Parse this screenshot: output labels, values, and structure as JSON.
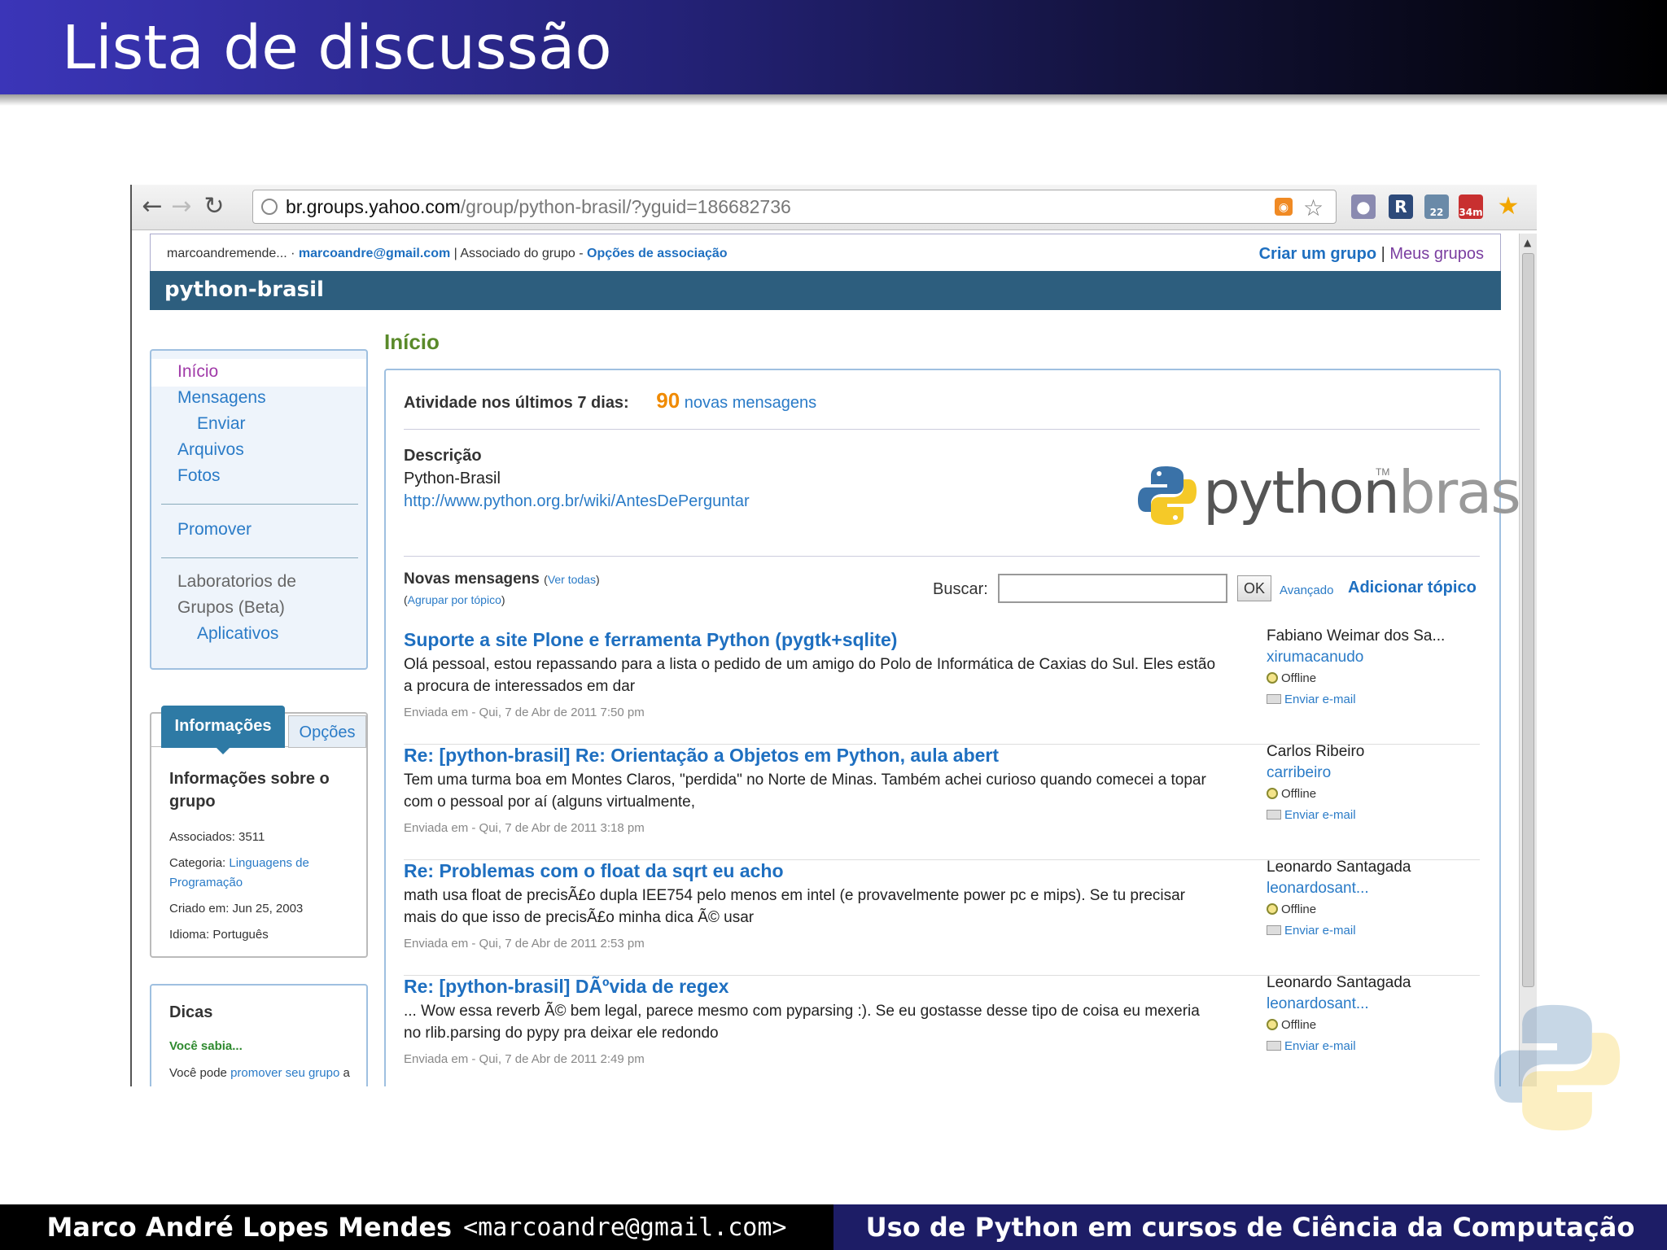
{
  "slide": {
    "title": "Lista de discussão",
    "footer_author": "Marco André Lopes Mendes",
    "footer_email": "<marcoandre@gmail.com>",
    "footer_talk": "Uso de Python em cursos de Ciência da Computação"
  },
  "browser": {
    "url_host": "br.groups.yahoo.com",
    "url_path": "/group/python-brasil/?yguid=186682736",
    "ext_badge_1": "22",
    "ext_badge_2": "34m"
  },
  "userbar": {
    "user": "marcoandremende... · ",
    "email": "marcoandre@gmail.com",
    "role": " | Associado do grupo - ",
    "options": "Opções de associação",
    "create": "Criar um grupo",
    "sep": " | ",
    "mine": "Meus grupos"
  },
  "group": {
    "name": "python-brasil"
  },
  "nav": {
    "items": [
      "Início",
      "Mensagens",
      "Enviar",
      "Arquivos",
      "Fotos",
      "Promover",
      "Laboratorios de",
      "Grupos (Beta)",
      "Aplicativos"
    ]
  },
  "info": {
    "tab_info": "Informações",
    "tab_options": "Opções",
    "heading": "Informações sobre o grupo",
    "members": "Associados: 3511",
    "category_label": "Categoria: ",
    "category_value": "Linguagens de Programação",
    "created": "Criado em: Jun 25, 2003",
    "language": "Idioma: Português"
  },
  "dicas": {
    "heading": "Dicas",
    "sub": "Você sabia...",
    "text_1": "Você pode ",
    "link": "promover seu grupo",
    "text_2": " a partir do seu próprio web site."
  },
  "main": {
    "title": "Início",
    "activity_label": "Atividade nos últimos 7 dias:",
    "activity_count": "90",
    "activity_text": "novas mensagens",
    "desc_label": "Descrição",
    "desc_text": "Python-Brasil",
    "desc_link": "http://www.python.org.br/wiki/AntesDePerguntar",
    "logo_python": "python",
    "logo_brasil": "brasil",
    "logo_tm": "TM",
    "new_msgs_label": "Novas mensagens",
    "ver_todas": "Ver todas",
    "agrupar": "Agrupar por tópico",
    "buscar": "Buscar:",
    "ok": "OK",
    "avancado": "Avançado",
    "add_topic": "Adicionar tópico"
  },
  "messages": [
    {
      "subject": "Suporte a site Plone e ferramenta Python (pygtk+sqlite)",
      "body": "Olá pessoal, estou repassando para a lista o pedido de um amigo do Polo de Informática de Caxias do Sul. Eles estão a procura de interessados em dar",
      "sent": "Enviada em - Qui, 7 de Abr de 2011 7:50 pm",
      "author": "Fabiano Weimar dos Sa...",
      "nick": "xirumacanudo",
      "status": "Offline",
      "email": "Enviar e-mail"
    },
    {
      "subject": "Re: [python-brasil] Re: Orientação a Objetos em Python, aula abert",
      "body": "Tem uma turma boa em Montes Claros, \"perdida\" no Norte de Minas. Também achei curioso quando comecei a topar com o pessoal por aí (alguns virtualmente,",
      "sent": "Enviada em - Qui, 7 de Abr de 2011 3:18 pm",
      "author": "Carlos Ribeiro",
      "nick": "carribeiro",
      "status": "Offline",
      "email": "Enviar e-mail"
    },
    {
      "subject": "Re: Problemas com o float da sqrt eu acho",
      "body": "math usa float de precisÃ£o dupla IEE754 pelo menos em intel (e provavelmente power pc e mips). Se tu precisar mais do que isso de precisÃ£o minha dica Ã© usar",
      "sent": "Enviada em - Qui, 7 de Abr de 2011 2:53 pm",
      "author": "Leonardo Santagada",
      "nick": "leonardosant...",
      "status": "Offline",
      "email": "Enviar e-mail"
    },
    {
      "subject": "Re: [python-brasil] DÃºvida de regex",
      "body": "... Wow essa reverb Ã© bem legal, parece mesmo com pyparsing :). Se eu gostasse desse tipo de coisa eu mexeria no rlib.parsing do pypy pra deixar ele redondo",
      "sent": "Enviada em - Qui, 7 de Abr de 2011 2:49 pm",
      "author": "Leonardo Santagada",
      "nick": "leonardosant...",
      "status": "Offline",
      "email": "Enviar e-mail"
    }
  ]
}
